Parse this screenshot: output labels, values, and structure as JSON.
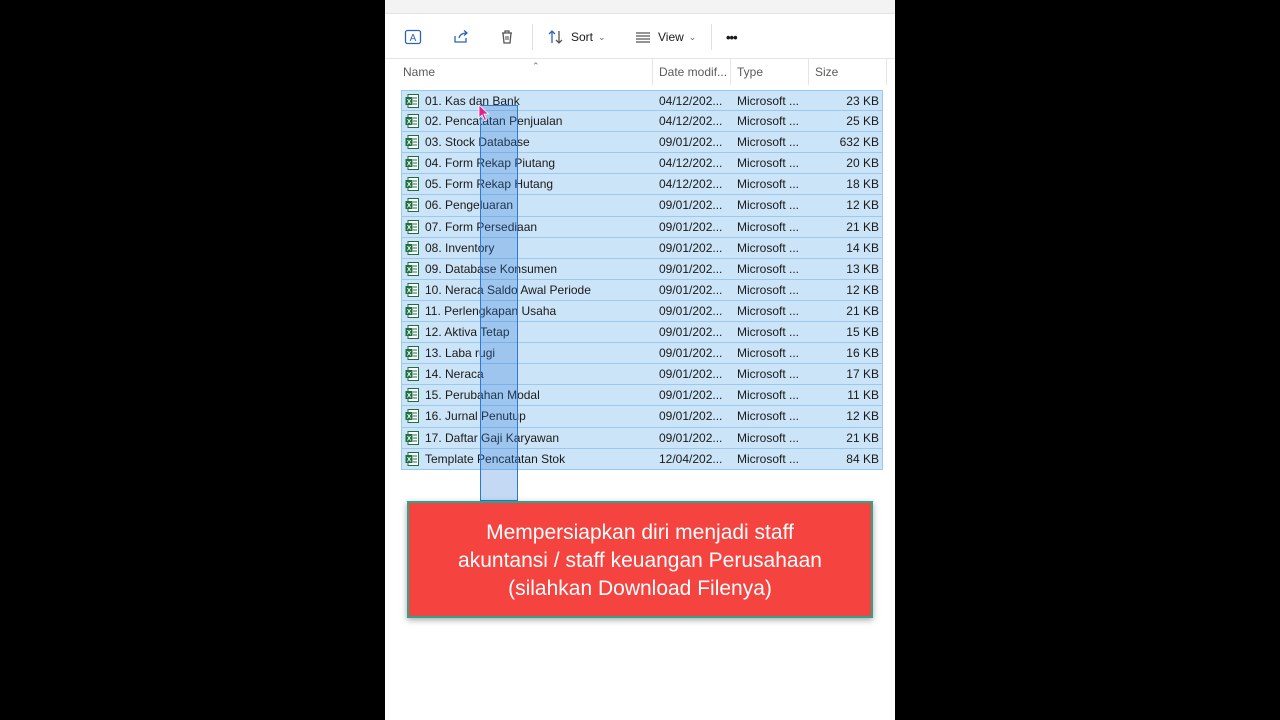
{
  "toolbar": {
    "rename_icon": "rename-icon",
    "share_icon": "share-icon",
    "delete_icon": "trash-icon",
    "sort_label": "Sort",
    "view_label": "View",
    "more_label": "•••"
  },
  "columns": {
    "name": "Name",
    "date": "Date modif...",
    "type": "Type",
    "size": "Size"
  },
  "files": [
    {
      "name": "01. Kas dan Bank",
      "date": "04/12/202...",
      "type": "Microsoft ...",
      "size": "23 KB"
    },
    {
      "name": "02. Pencatatan Penjualan",
      "date": "04/12/202...",
      "type": "Microsoft ...",
      "size": "25 KB"
    },
    {
      "name": "03. Stock Database",
      "date": "09/01/202...",
      "type": "Microsoft ...",
      "size": "632 KB"
    },
    {
      "name": "04. Form Rekap Piutang",
      "date": "04/12/202...",
      "type": "Microsoft ...",
      "size": "20 KB"
    },
    {
      "name": "05. Form Rekap Hutang",
      "date": "04/12/202...",
      "type": "Microsoft ...",
      "size": "18 KB"
    },
    {
      "name": "06. Pengeluaran",
      "date": "09/01/202...",
      "type": "Microsoft ...",
      "size": "12 KB"
    },
    {
      "name": "07. Form Persediaan",
      "date": "09/01/202...",
      "type": "Microsoft ...",
      "size": "21 KB"
    },
    {
      "name": "08. Inventory",
      "date": "09/01/202...",
      "type": "Microsoft ...",
      "size": "14 KB"
    },
    {
      "name": "09. Database Konsumen",
      "date": "09/01/202...",
      "type": "Microsoft ...",
      "size": "13 KB"
    },
    {
      "name": "10. Neraca Saldo Awal Periode",
      "date": "09/01/202...",
      "type": "Microsoft ...",
      "size": "12 KB"
    },
    {
      "name": "11. Perlengkapan Usaha",
      "date": "09/01/202...",
      "type": "Microsoft ...",
      "size": "21 KB"
    },
    {
      "name": "12. Aktiva Tetap",
      "date": "09/01/202...",
      "type": "Microsoft ...",
      "size": "15 KB"
    },
    {
      "name": "13. Laba rugi",
      "date": "09/01/202...",
      "type": "Microsoft ...",
      "size": "16 KB"
    },
    {
      "name": "14. Neraca",
      "date": "09/01/202...",
      "type": "Microsoft ...",
      "size": "17 KB"
    },
    {
      "name": "15. Perubahan Modal",
      "date": "09/01/202...",
      "type": "Microsoft ...",
      "size": "11 KB"
    },
    {
      "name": "16. Jurnal Penutup",
      "date": "09/01/202...",
      "type": "Microsoft ...",
      "size": "12 KB"
    },
    {
      "name": "17. Daftar Gaji Karyawan",
      "date": "09/01/202...",
      "type": "Microsoft ...",
      "size": "21 KB"
    },
    {
      "name": "Template Pencatatan Stok",
      "date": "12/04/202...",
      "type": "Microsoft ...",
      "size": "84 KB"
    }
  ],
  "banner": {
    "line1": "Mempersiapkan diri menjadi staff",
    "line2": "akuntansi / staff keuangan Perusahaan",
    "line3": "(silahkan Download Filenya)"
  },
  "colors": {
    "selection": "#cce4f7",
    "selection_border": "#99c9ef",
    "banner": "#f5433f",
    "excel": "#1d6f42"
  }
}
